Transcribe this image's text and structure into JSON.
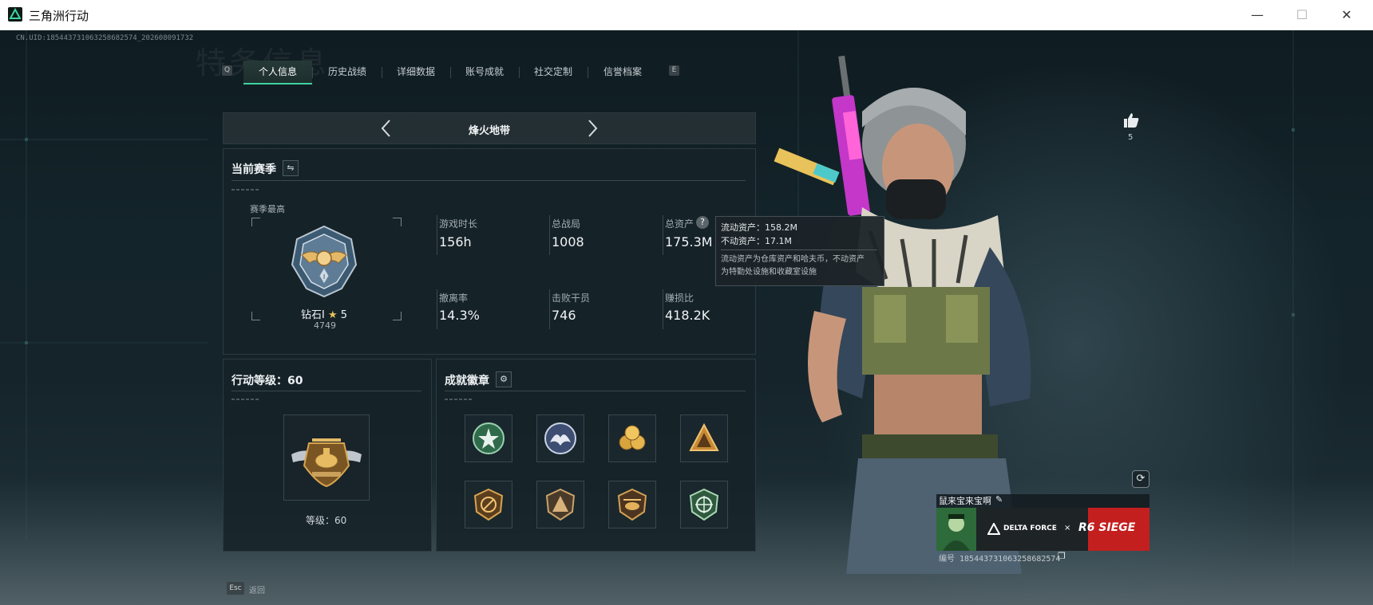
{
  "window": {
    "title": "三角洲行动",
    "minimize": "—",
    "maximize": "☐",
    "close": "✕"
  },
  "uid_line": "CN.UID:185443731063258682574_202608091732",
  "background_heading": "特务信息",
  "tabs": {
    "left_key": "Q",
    "right_key": "E",
    "items": [
      {
        "label": "个人信息",
        "active": true
      },
      {
        "label": "历史战绩",
        "active": false
      },
      {
        "label": "详细数据",
        "active": false
      },
      {
        "label": "账号成就",
        "active": false
      },
      {
        "label": "社交定制",
        "active": false
      },
      {
        "label": "信誉档案",
        "active": false
      }
    ]
  },
  "mode_selector": {
    "label": "烽火地带",
    "prev_icon": "chevron-left-icon",
    "next_icon": "chevron-right-icon"
  },
  "season": {
    "title": "当前赛季",
    "switch_icon": "swap-icon",
    "season_best_label": "赛季最高",
    "rank_name": "钻石I",
    "rank_stars": "5",
    "rank_points": "4749",
    "stats": [
      {
        "label": "游戏时长",
        "value": "156h"
      },
      {
        "label": "总战局",
        "value": "1008"
      },
      {
        "label": "总资产",
        "value": "175.3M",
        "has_help": true
      },
      {
        "label": "撤离率",
        "value": "14.3%"
      },
      {
        "label": "击败干员",
        "value": "746"
      },
      {
        "label": "赚损比",
        "value": "418.2K"
      }
    ]
  },
  "tooltip": {
    "liquid": "流动资产：158.2M",
    "fixed": "不动资产：17.1M",
    "desc_line1": "流动资产为仓库资产和哈夫币，不动资产",
    "desc_line2": "为特勤处设施和收藏室设施"
  },
  "level": {
    "title": "行动等级：60",
    "level_text": "等级：60"
  },
  "achievements": {
    "title": "成就徽章",
    "settings_icon": "gear-icon",
    "badges": [
      "star-shield-badge-icon",
      "eagle-badge-icon",
      "coins-badge-icon",
      "triangle-badge-icon",
      "no-entry-badge-icon",
      "pyramid-badge-icon",
      "helicopter-badge-icon",
      "target-shield-badge-icon"
    ]
  },
  "likes": {
    "icon": "thumbs-up-icon",
    "count": "5"
  },
  "profile_card": {
    "name": "鼠来宝来宝啊",
    "edit_icon": "pencil-icon",
    "banner_left": "DELTA FORCE",
    "banner_x": "×",
    "banner_right": "R6 SIEGE",
    "id_text": "编号 185443731063258682574",
    "copy_icon": "copy-icon"
  },
  "footer": {
    "key": "Esc",
    "label": "返回"
  },
  "colors": {
    "accent": "#3fd3a0",
    "banner_red": "#c41f1f"
  }
}
